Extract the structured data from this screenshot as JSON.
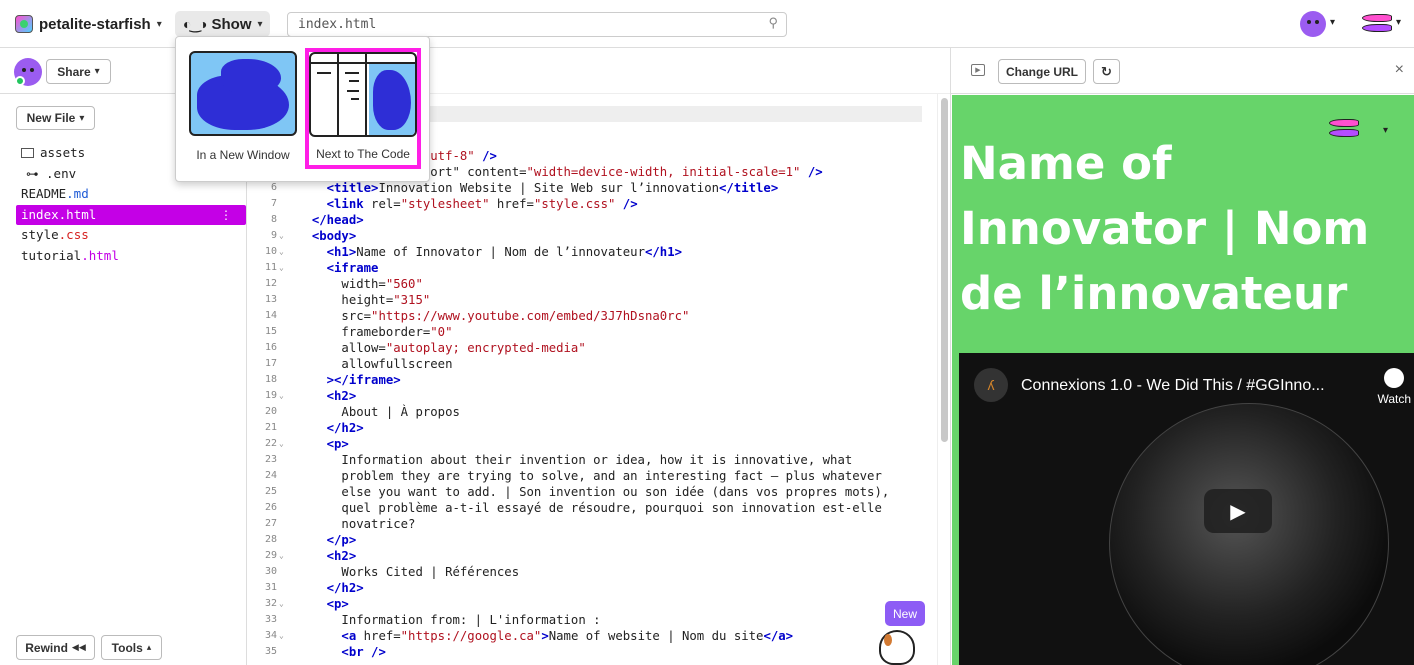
{
  "topbar": {
    "project_name": "petalite-starfish",
    "show_label": "Show",
    "url_value": "index.html"
  },
  "sidebar": {
    "share_label": "Share",
    "new_file_label": "New File",
    "files": [
      {
        "name": "assets",
        "ext": ""
      },
      {
        "name": ".env",
        "ext": ""
      },
      {
        "name": "README",
        "ext": ".md"
      },
      {
        "name": "index",
        "ext": ".html"
      },
      {
        "name": "style",
        "ext": ".css"
      },
      {
        "name": "tutorial",
        "ext": ".html"
      }
    ],
    "rewind_label": "Rewind",
    "tools_label": "Tools"
  },
  "show_menu": {
    "option_new_window": "In a New Window",
    "option_next_to_code": "Next to The Code"
  },
  "editor": {
    "lines": [
      {
        "num": "",
        "html": "                <span class=\"str\">=\"utf-8\"</span> <span class=\"tag\">/></span>"
      },
      {
        "num": "",
        "html": "              iewport\" content=<span class=\"str\">\"width=device-width, initial-scale=1\"</span> <span class=\"tag\">/></span>"
      },
      {
        "num": "6",
        "html": "    <span class=\"tag\">&lt;title></span>Innovation Website | Site Web sur l’innovation<span class=\"tag\">&lt;/title></span>"
      },
      {
        "num": "7",
        "html": "    <span class=\"tag\">&lt;link</span> rel=<span class=\"str\">\"stylesheet\"</span> href=<span class=\"str\">\"style.css\"</span> <span class=\"tag\">/></span>"
      },
      {
        "num": "8",
        "html": "  <span class=\"tag\">&lt;/head></span>"
      },
      {
        "num": "9",
        "fold": true,
        "html": "  <span class=\"tag\">&lt;body></span>"
      },
      {
        "num": "10",
        "fold": true,
        "html": "    <span class=\"tag\">&lt;h1></span>Name of Innovator | Nom de l’innovateur<span class=\"tag\">&lt;/h1></span>"
      },
      {
        "num": "11",
        "fold": true,
        "html": "    <span class=\"tag\">&lt;iframe</span>"
      },
      {
        "num": "12",
        "html": "      width=<span class=\"str\">\"560\"</span>"
      },
      {
        "num": "13",
        "html": "      height=<span class=\"str\">\"315\"</span>"
      },
      {
        "num": "14",
        "html": "      src=<span class=\"str\">\"https://www.youtube.com/embed/3J7hDsna0rc\"</span>"
      },
      {
        "num": "15",
        "html": "      frameborder=<span class=\"str\">\"0\"</span>"
      },
      {
        "num": "16",
        "html": "      allow=<span class=\"str\">\"autoplay; encrypted-media\"</span>"
      },
      {
        "num": "17",
        "html": "      allowfullscreen"
      },
      {
        "num": "18",
        "html": "    <span class=\"tag\">>&lt;/iframe></span>"
      },
      {
        "num": "19",
        "fold": true,
        "html": "    <span class=\"tag\">&lt;h2></span>"
      },
      {
        "num": "20",
        "html": "      About | À propos"
      },
      {
        "num": "21",
        "html": "    <span class=\"tag\">&lt;/h2></span>"
      },
      {
        "num": "22",
        "fold": true,
        "html": "    <span class=\"tag\">&lt;p></span>"
      },
      {
        "num": "23",
        "html": "      Information about their invention or idea, how it is innovative, what"
      },
      {
        "num": "24",
        "html": "      problem they are trying to solve, and an interesting fact – plus whatever"
      },
      {
        "num": "25",
        "html": "      else you want to add. | Son invention ou son idée (dans vos propres mots),"
      },
      {
        "num": "26",
        "html": "      quel problème a-t-il essayé de résoudre, pourquoi son innovation est-elle"
      },
      {
        "num": "27",
        "html": "      novatrice?"
      },
      {
        "num": "28",
        "html": "    <span class=\"tag\">&lt;/p></span>"
      },
      {
        "num": "29",
        "fold": true,
        "html": "    <span class=\"tag\">&lt;h2></span>"
      },
      {
        "num": "30",
        "html": "      Works Cited | Références"
      },
      {
        "num": "31",
        "html": "    <span class=\"tag\">&lt;/h2></span>"
      },
      {
        "num": "32",
        "fold": true,
        "html": "    <span class=\"tag\">&lt;p></span>"
      },
      {
        "num": "33",
        "html": "      Information from: | L'information :"
      },
      {
        "num": "34",
        "fold": true,
        "html": "      <span class=\"tag\">&lt;a</span> href=<span class=\"str\">\"https://google.ca\"</span><span class=\"tag\">></span>Name of website | Nom du site<span class=\"tag\">&lt;/a></span>"
      },
      {
        "num": "35",
        "html": "      <span class=\"tag\">&lt;br /></span>"
      }
    ],
    "new_badge": "New"
  },
  "preview": {
    "change_url_label": "Change URL",
    "heading": "Name of Innovator | Nom de l’innovateur",
    "video_title": "Connexions 1.0 - We Did This / #GGInno...",
    "watch_label": "Watch",
    "bg_color": "#67d46a"
  }
}
